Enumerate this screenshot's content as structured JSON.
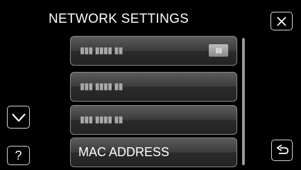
{
  "header": {
    "title": "NETWORK SETTINGS"
  },
  "list": {
    "items": [
      {
        "label": "▮▮▮ ▮▮▮▮ ▮▮",
        "badge": "▮▮"
      },
      {
        "label": "▮▮▮ ▮▮▮▮ ▮▮"
      },
      {
        "label": "▮▮▮ ▮▮▮▮ ▮▮"
      },
      {
        "label": "MAC ADDRESS"
      }
    ]
  },
  "controls": {
    "help_label": "?"
  },
  "icons": {
    "close": "close-icon",
    "scroll_down": "chevron-down-icon",
    "back": "return-arrow-icon"
  }
}
